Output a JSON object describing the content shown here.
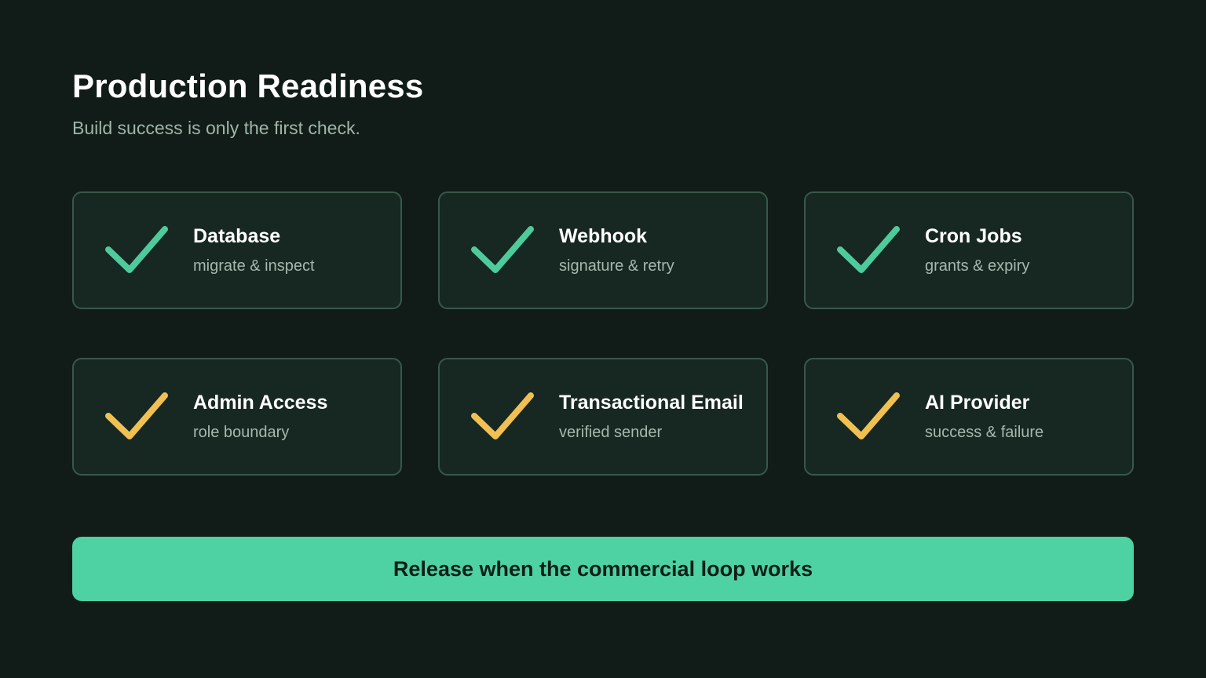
{
  "header": {
    "title": "Production Readiness",
    "subtitle": "Build success is only the first check."
  },
  "colors": {
    "background": "#111c18",
    "card_bg": "#172722",
    "card_border": "#38584a",
    "check_green": "#4ecb9c",
    "check_yellow": "#f0c152",
    "button_bg": "#4ed1a3"
  },
  "cards": [
    {
      "title": "Database",
      "subtitle": "migrate & inspect",
      "icon": "check-icon",
      "status": "green"
    },
    {
      "title": "Webhook",
      "subtitle": "signature & retry",
      "icon": "check-icon",
      "status": "green"
    },
    {
      "title": "Cron Jobs",
      "subtitle": "grants & expiry",
      "icon": "check-icon",
      "status": "green"
    },
    {
      "title": "Admin Access",
      "subtitle": "role boundary",
      "icon": "check-icon",
      "status": "yellow"
    },
    {
      "title": "Transactional Email",
      "subtitle": "verified sender",
      "icon": "check-icon",
      "status": "yellow"
    },
    {
      "title": "AI Provider",
      "subtitle": "success & failure",
      "icon": "check-icon",
      "status": "yellow"
    }
  ],
  "cta": {
    "label": "Release when the commercial loop works"
  }
}
